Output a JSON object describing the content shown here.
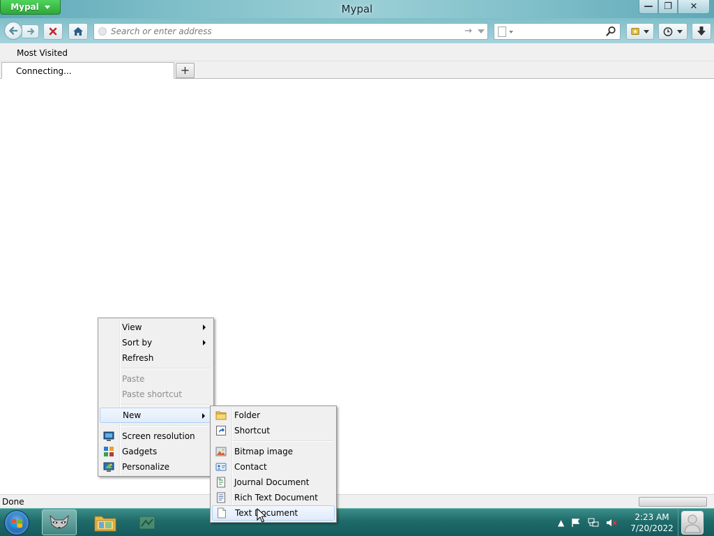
{
  "window": {
    "app_button_label": "Mypal",
    "title": "Mypal",
    "controls": {
      "minimize": "—",
      "restore": "❐",
      "close": "✕"
    }
  },
  "navbar": {
    "address_placeholder": "Search or enter address",
    "address_value": "",
    "search_value": ""
  },
  "bookmarks_bar": {
    "items": [
      {
        "label": "Most Visited"
      }
    ]
  },
  "tabs": [
    {
      "label": "Connecting..."
    }
  ],
  "statusbar": {
    "text": "Done",
    "progress": 0
  },
  "context_menu": {
    "items": [
      {
        "label": "View",
        "submenu": true
      },
      {
        "label": "Sort by",
        "submenu": true
      },
      {
        "label": "Refresh"
      },
      {
        "label": "Paste",
        "disabled": true
      },
      {
        "label": "Paste shortcut",
        "disabled": true
      },
      {
        "label": "New",
        "submenu": true,
        "highlighted": true
      },
      {
        "label": "Screen resolution",
        "icon": "screen-resolution-icon"
      },
      {
        "label": "Gadgets",
        "icon": "gadgets-icon"
      },
      {
        "label": "Personalize",
        "icon": "personalize-icon"
      }
    ]
  },
  "new_submenu": {
    "items": [
      {
        "label": "Folder",
        "icon": "folder-icon"
      },
      {
        "label": "Shortcut",
        "icon": "shortcut-icon"
      },
      {
        "label": "Bitmap image",
        "icon": "bitmap-image-icon"
      },
      {
        "label": "Contact",
        "icon": "contact-icon"
      },
      {
        "label": "Journal Document",
        "icon": "journal-document-icon"
      },
      {
        "label": "Rich Text Document",
        "icon": "rich-text-document-icon"
      },
      {
        "label": "Text Document",
        "icon": "text-document-icon",
        "highlighted": true
      }
    ]
  },
  "taskbar": {
    "clock_time": "2:23 AM",
    "clock_date": "7/20/2022"
  },
  "colors": {
    "app_button": "#2ea93a",
    "taskbar": "#1f6b6a",
    "menu_bg": "#f0f0f0",
    "highlight": "#e0ecfb"
  }
}
